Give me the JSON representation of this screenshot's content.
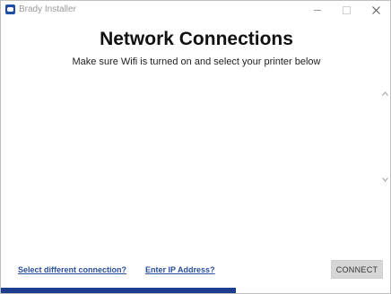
{
  "window": {
    "title": "Brady Installer"
  },
  "main": {
    "title": "Network Connections",
    "subtitle": "Make sure Wifi is turned on and select your printer below"
  },
  "printers": [],
  "footer": {
    "select_connection_link": "Select different connection?",
    "enter_ip_link": "Enter IP Address?",
    "connect_button": "CONNECT"
  },
  "progress": {
    "fraction": 0.6
  },
  "colors": {
    "accent": "#1e3d8f",
    "link": "#2a4d9b",
    "button_bg": "#d6d6d6"
  },
  "icons": {
    "app": "brady-app-icon",
    "minimize": "minimize-icon",
    "maximize": "maximize-icon",
    "close": "close-icon",
    "scroll_up": "scroll-up-icon",
    "scroll_down": "scroll-down-icon"
  }
}
